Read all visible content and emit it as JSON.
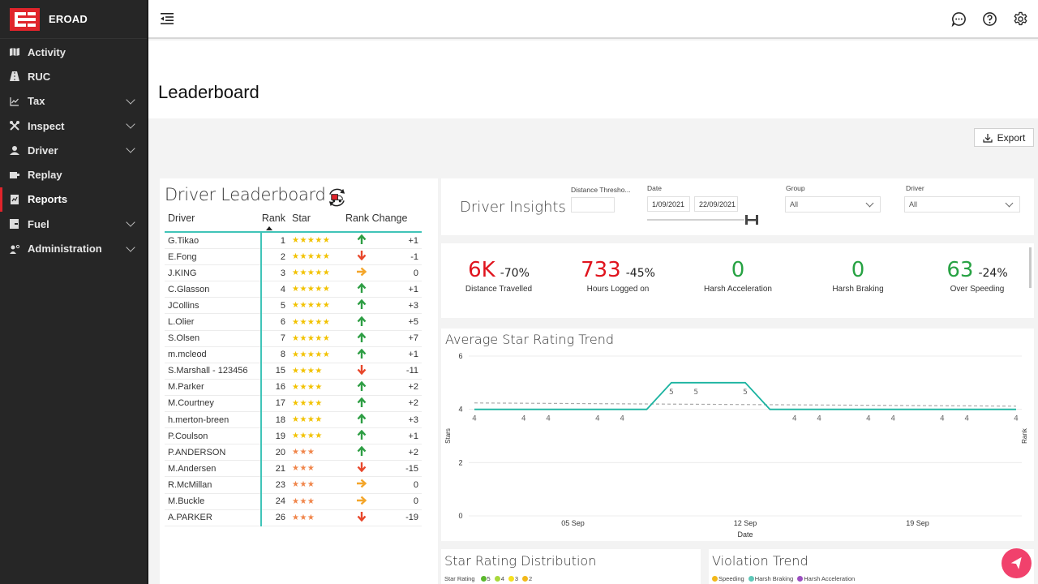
{
  "app": {
    "brand_name": "EROAD",
    "brand_color": "#e0242b"
  },
  "sidebar": {
    "items": [
      {
        "label": "Activity",
        "icon": "map-icon",
        "expandable": false,
        "active": false
      },
      {
        "label": "RUC",
        "icon": "road-icon",
        "expandable": false,
        "active": false
      },
      {
        "label": "Tax",
        "icon": "line-chart-icon",
        "expandable": true,
        "active": false
      },
      {
        "label": "Inspect",
        "icon": "tools-icon",
        "expandable": true,
        "active": false
      },
      {
        "label": "Driver",
        "icon": "user-icon",
        "expandable": true,
        "active": false
      },
      {
        "label": "Replay",
        "icon": "replay-icon",
        "expandable": false,
        "active": false
      },
      {
        "label": "Reports",
        "icon": "report-icon",
        "expandable": false,
        "active": true
      },
      {
        "label": "Fuel",
        "icon": "fuel-icon",
        "expandable": true,
        "active": false
      },
      {
        "label": "Administration",
        "icon": "user-gear-icon",
        "expandable": true,
        "active": false
      }
    ]
  },
  "topbar": {
    "icons": [
      "chat-icon",
      "help-icon",
      "settings-icon"
    ]
  },
  "page": {
    "title": "Leaderboard",
    "export_label": "Export"
  },
  "leaderboard": {
    "title": "Driver Leaderboard",
    "columns": {
      "driver": "Driver",
      "rank": "Rank",
      "star": "Star",
      "rank_change": "Rank Change"
    },
    "rows": [
      {
        "driver": "G.Tikao",
        "rank": "1",
        "stars": 5,
        "trend": "up",
        "change": "+1"
      },
      {
        "driver": "E.Fong",
        "rank": "2",
        "stars": 5,
        "trend": "down",
        "change": "-1"
      },
      {
        "driver": "J.KING",
        "rank": "3",
        "stars": 5,
        "trend": "same",
        "change": "0"
      },
      {
        "driver": "C.Glasson",
        "rank": "4",
        "stars": 5,
        "trend": "up",
        "change": "+1"
      },
      {
        "driver": "JCollins",
        "rank": "5",
        "stars": 5,
        "trend": "up",
        "change": "+3"
      },
      {
        "driver": "L.Olier",
        "rank": "6",
        "stars": 5,
        "trend": "up",
        "change": "+5"
      },
      {
        "driver": "S.Olsen",
        "rank": "7",
        "stars": 5,
        "trend": "up",
        "change": "+7"
      },
      {
        "driver": "m.mcleod",
        "rank": "8",
        "stars": 5,
        "trend": "up",
        "change": "+1"
      },
      {
        "driver": "S.Marshall - 123456",
        "rank": "15",
        "stars": 4,
        "trend": "down",
        "change": "-11"
      },
      {
        "driver": "M.Parker",
        "rank": "16",
        "stars": 4,
        "trend": "up",
        "change": "+2"
      },
      {
        "driver": "M.Courtney",
        "rank": "17",
        "stars": 4,
        "trend": "up",
        "change": "+2"
      },
      {
        "driver": "h.merton-breen",
        "rank": "18",
        "stars": 4,
        "trend": "up",
        "change": "+3"
      },
      {
        "driver": "P.Coulson",
        "rank": "19",
        "stars": 4,
        "trend": "up",
        "change": "+1"
      },
      {
        "driver": "P.ANDERSON",
        "rank": "20",
        "stars": 3,
        "trend": "up",
        "change": "+2"
      },
      {
        "driver": "M.Andersen",
        "rank": "21",
        "stars": 3,
        "trend": "down",
        "change": "-15"
      },
      {
        "driver": "R.McMillan",
        "rank": "23",
        "stars": 3,
        "trend": "same",
        "change": "0"
      },
      {
        "driver": "M.Buckle",
        "rank": "24",
        "stars": 3,
        "trend": "same",
        "change": "0"
      },
      {
        "driver": "A.PARKER",
        "rank": "26",
        "stars": 3,
        "trend": "down",
        "change": "-19"
      }
    ],
    "colors": {
      "up": "#2e9e44",
      "down": "#e8472b",
      "same": "#f4a62a",
      "stars_high": "#f2c200",
      "stars_low": "#f0854a",
      "accent": "#40c4b8"
    }
  },
  "insights": {
    "title": "Driver Insights",
    "distance_threshold_label": "Distance Thresho...",
    "distance_threshold_value": "",
    "date_label": "Date",
    "date_from": "1/09/2021",
    "date_to": "22/09/2021",
    "group_label": "Group",
    "group_value": "All",
    "driver_label": "Driver",
    "driver_value": "All"
  },
  "kpis": [
    {
      "value": "6K",
      "delta": "-70%",
      "label": "Distance Travelled",
      "color": "#e0141e"
    },
    {
      "value": "733",
      "delta": "-45%",
      "label": "Hours Logged on",
      "color": "#e0141e"
    },
    {
      "value": "0",
      "delta": "",
      "label": "Harsh Acceleration",
      "color": "#27a243"
    },
    {
      "value": "0",
      "delta": "",
      "label": "Harsh Braking",
      "color": "#27a243"
    },
    {
      "value": "63",
      "delta": "-24%",
      "label": "Over Speeding",
      "color": "#27a243"
    }
  ],
  "chart_data": {
    "type": "line",
    "title": "Average Star Rating Trend",
    "xlabel": "Date",
    "ylabel": "Stars",
    "y2label": "Rank",
    "ylim": [
      0,
      6
    ],
    "yticks": [
      "0",
      "2",
      "4",
      "6"
    ],
    "xticks": [
      {
        "day": 5,
        "label": "05 Sep"
      },
      {
        "day": 12,
        "label": "12 Sep"
      },
      {
        "day": 19,
        "label": "19 Sep"
      }
    ],
    "xlim_days": [
      1,
      23
    ],
    "grid": true,
    "series": [
      {
        "name": "Average Star Rating",
        "color": "#1ab3a0",
        "points": [
          {
            "day": 1,
            "value": 4,
            "label": true
          },
          {
            "day": 2,
            "value": 4,
            "label": false
          },
          {
            "day": 3,
            "value": 4,
            "label": true
          },
          {
            "day": 4,
            "value": 4,
            "label": true
          },
          {
            "day": 5,
            "value": 4,
            "label": false
          },
          {
            "day": 6,
            "value": 4,
            "label": true
          },
          {
            "day": 7,
            "value": 4,
            "label": true
          },
          {
            "day": 8,
            "value": 4,
            "label": false
          },
          {
            "day": 9,
            "value": 5,
            "label": true
          },
          {
            "day": 10,
            "value": 5,
            "label": true
          },
          {
            "day": 11,
            "value": 5,
            "label": false
          },
          {
            "day": 12,
            "value": 5,
            "label": true
          },
          {
            "day": 13,
            "value": 4,
            "label": false
          },
          {
            "day": 14,
            "value": 4,
            "label": true
          },
          {
            "day": 15,
            "value": 4,
            "label": true
          },
          {
            "day": 16,
            "value": 4,
            "label": false
          },
          {
            "day": 17,
            "value": 4,
            "label": true
          },
          {
            "day": 18,
            "value": 4,
            "label": true
          },
          {
            "day": 19,
            "value": 4,
            "label": false
          },
          {
            "day": 20,
            "value": 4,
            "label": true
          },
          {
            "day": 21,
            "value": 4,
            "label": true
          },
          {
            "day": 22,
            "value": 4,
            "label": false
          },
          {
            "day": 23,
            "value": 4,
            "label": true
          }
        ]
      }
    ],
    "trend_line": {
      "name": "Trend",
      "color": "#aaaaaa",
      "start": {
        "day": 1,
        "value": 4.24
      },
      "end": {
        "day": 23,
        "value": 4.12
      }
    }
  },
  "distribution": {
    "title": "Star Rating Distribution",
    "legend_title": "Star Rating",
    "legend": [
      {
        "label": "5",
        "color": "#5cb82e"
      },
      {
        "label": "4",
        "color": "#a8d83c"
      },
      {
        "label": "3",
        "color": "#f5e020"
      },
      {
        "label": "2",
        "color": "#f2b81a"
      }
    ]
  },
  "violation": {
    "title": "Violation Trend",
    "legend": [
      {
        "label": "Speeding",
        "color": "#f2b81a"
      },
      {
        "label": "Harsh Braking",
        "color": "#5fc7b8"
      },
      {
        "label": "Harsh Acceleration",
        "color": "#9b4fc0"
      }
    ]
  }
}
